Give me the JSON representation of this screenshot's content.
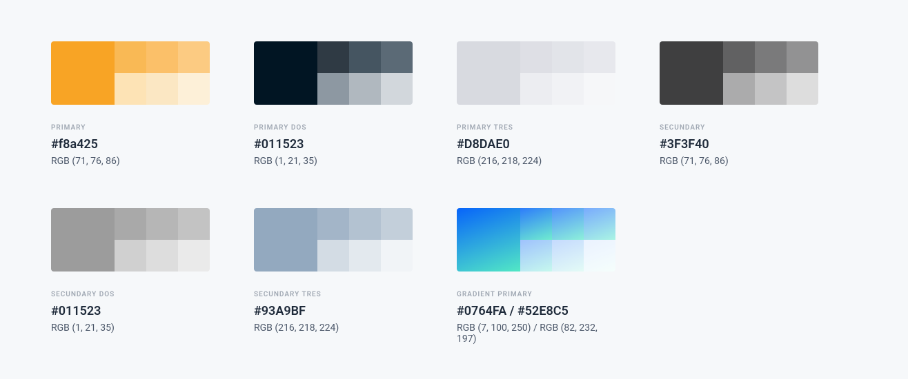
{
  "cards": [
    {
      "label": "PRIMARY",
      "hex": "#f8a425",
      "rgb": "RGB (71, 76, 86)",
      "swatches": {
        "primary": "#f8a425",
        "top": [
          "#f9b955",
          "#fbc069",
          "#fccb82"
        ],
        "bottom": [
          "#fde3b5",
          "#fbe7c3",
          "#fdf0d8"
        ]
      }
    },
    {
      "label": "PRIMARY DOS",
      "hex": "#011523",
      "rgb": "RGB (1, 21, 35)",
      "swatches": {
        "primary": "#011523",
        "top": [
          "#2f3a44",
          "#455561",
          "#5b6a76"
        ],
        "bottom": [
          "#8d98a2",
          "#b0b8bf",
          "#d2d7dc"
        ]
      }
    },
    {
      "label": "PRIMARY TRES",
      "hex": "#D8DAE0",
      "rgb": "RGB (216, 218, 224)",
      "swatches": {
        "primary": "#d8dae0",
        "top": [
          "#dedfe5",
          "#e2e4e9",
          "#e7e8ed"
        ],
        "bottom": [
          "#ecedf1",
          "#f1f2f5",
          "#f6f7f9"
        ]
      }
    },
    {
      "label": "SECUNDARY",
      "hex": "#3F3F40",
      "rgb": "RGB (71, 76, 86)",
      "swatches": {
        "primary": "#3f3f40",
        "top": [
          "#616162",
          "#7a7a7b",
          "#929293"
        ],
        "bottom": [
          "#ababac",
          "#c4c4c5",
          "#dddddd"
        ]
      }
    },
    {
      "label": "SECUNDARY DOS",
      "hex": "#011523",
      "rgb": "RGB (1, 21, 35)",
      "swatches": {
        "primary": "#9c9c9c",
        "top": [
          "#a9a9a9",
          "#b6b6b6",
          "#c3c3c3"
        ],
        "bottom": [
          "#d0d0d0",
          "#dddddd",
          "#eaeaea"
        ]
      }
    },
    {
      "label": "SECUNDARY TRES",
      "hex": "#93A9BF",
      "rgb": "RGB (216, 218, 224)",
      "swatches": {
        "primary": "#93a9bf",
        "top": [
          "#a3b5c8",
          "#b3c2d1",
          "#c3cfda"
        ],
        "bottom": [
          "#d3dce4",
          "#e3e9ee",
          "#f1f4f7"
        ]
      }
    },
    {
      "label": "GRADIENT PRIMARY",
      "hex": "#0764FA / #52E8C5",
      "rgb": "RGB (7, 100, 250) /  RGB (82, 232, 197)",
      "swatches": {
        "gradient": true,
        "primary": [
          "#0764fa",
          "#52e8c5"
        ],
        "top": [
          [
            "#2d7cfb",
            "#6fecd0"
          ],
          [
            "#5393fc",
            "#8cf0da"
          ],
          [
            "#79abfd",
            "#a9f4e4"
          ]
        ],
        "bottom": [
          [
            "#9fc2fd",
            "#c6f8ee"
          ],
          [
            "#c5dafe",
            "#e3fbf6"
          ],
          [
            "#ebf2ff",
            "#f5fefc"
          ]
        ]
      }
    }
  ]
}
